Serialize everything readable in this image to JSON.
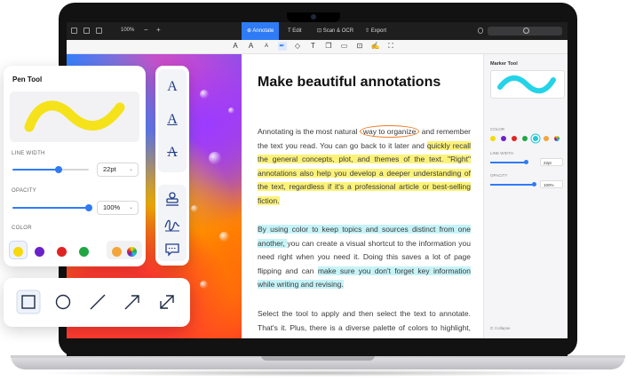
{
  "app": {
    "zoom": "100%",
    "zoom_minus": "−",
    "zoom_plus": "+",
    "tabs": [
      {
        "label": "Annotate",
        "active": true
      },
      {
        "label": "Edit",
        "active": false
      },
      {
        "label": "Scan & OCR",
        "active": false
      },
      {
        "label": "Export",
        "active": false
      }
    ],
    "subtoolbar_icons": [
      "text-box-icon",
      "text-large-icon",
      "text-small-icon",
      "pen-icon",
      "eraser-icon",
      "text-field-icon",
      "copy-icon",
      "comment-icon",
      "stamp-icon",
      "signature-icon",
      "crop-icon"
    ],
    "subtoolbar_glyphs": [
      "A",
      "A",
      "A",
      "✒",
      "◇",
      "T",
      "❐",
      "▭",
      "⊡",
      "✍",
      "⛶"
    ]
  },
  "document": {
    "title": "Make beautiful annotations",
    "paragraphs": [
      [
        {
          "text": "Annotating is the most natural ",
          "style": ""
        },
        {
          "text": "way to organize",
          "style": "circle"
        },
        {
          "text": " and remember the text you read. You can go back to it later and ",
          "style": ""
        },
        {
          "text": "quickly recall the general concepts, plot, and themes of the text. \"Right\" annotations also help you develop a deeper understanding of the text, regardless if it's a professional article or best-selling fiction.",
          "style": "yellow"
        }
      ],
      [
        {
          "text": "By using color to keep topics and sources distinct from one another, ",
          "style": "cyan"
        },
        {
          "text": "you can create a visual shortcut to the information you need right when you need it. Doing this saves a lot of page flipping and can ",
          "style": ""
        },
        {
          "text": "make sure you don't forget key information while writing and revising.",
          "style": "cyan"
        }
      ],
      [
        {
          "text": "Select the tool to apply and then select the text to annotate. That's it. Plus, there is a diverse palette of colors to highlight, strikeout and underline your text.",
          "style": ""
        }
      ]
    ]
  },
  "right_panel": {
    "title": "Marker Tool",
    "color_label": "COLOR",
    "line_width_label": "LINE WIDTH",
    "line_width_value": "22pt",
    "opacity_label": "OPACITY",
    "opacity_value": "100%",
    "collapse_label": "Collapse",
    "colors": [
      "#f5d90a",
      "#6b21c8",
      "#e02424",
      "#22a645",
      "#23c7d8",
      "#f4a53a",
      "#f06fb0"
    ]
  },
  "pen_tool": {
    "title": "Pen Tool",
    "line_width_label": "LINE WIDTH",
    "line_width_value": "22pt",
    "line_width_level": 0.6,
    "opacity_label": "OPACITY",
    "opacity_value": "100%",
    "opacity_level": 1.0,
    "color_label": "COLOR",
    "stroke_color": "#f5e21a",
    "colors": [
      "#f5d90a",
      "#6b21c8",
      "#e02424",
      "#22a645",
      "#f4a53a"
    ],
    "selected_color": "#f5d90a",
    "chevron": "⌄"
  },
  "text_tools": {
    "items": [
      {
        "name": "text-plain-tool",
        "glyph": "A"
      },
      {
        "name": "text-underline-tool",
        "glyph": "A"
      },
      {
        "name": "text-strikeout-tool",
        "glyph": "A"
      }
    ]
  },
  "shape_tools": [
    "rectangle",
    "ellipse",
    "line",
    "arrow",
    "double-arrow"
  ],
  "colors": {
    "accent": "#2f7bf5",
    "highlight_yellow": "#fbf27a",
    "highlight_cyan": "#c6f3f7",
    "circle_mark": "#f07c2a"
  }
}
